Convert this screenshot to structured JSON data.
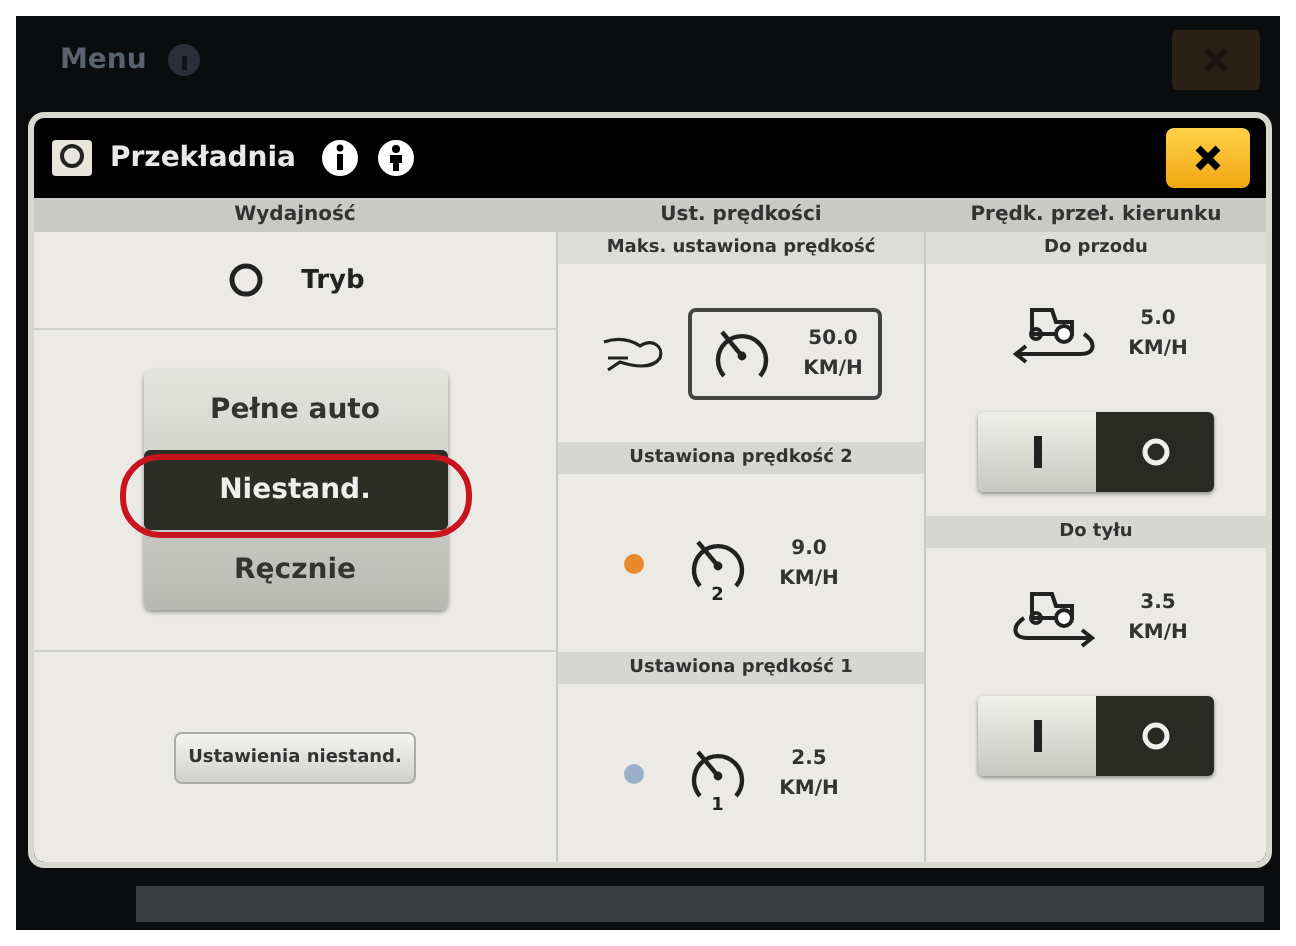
{
  "menu_bar": {
    "title": "Menu"
  },
  "dialog": {
    "title": "Przekładnia",
    "performance": {
      "heading": "Wydajność",
      "mode_label": "Tryb",
      "modes": [
        {
          "label": "Pełne auto",
          "selected": false
        },
        {
          "label": "Niestand.",
          "selected": true
        },
        {
          "label": "Ręcznie",
          "selected": false
        }
      ],
      "settings_button": "Ustawienia niestand."
    },
    "set_speeds": {
      "heading": "Ust. prędkości",
      "presets": [
        {
          "kind": "max",
          "label": "Maks. ustawiona prędkość",
          "value": "50.0",
          "unit": "KM/H",
          "selected": true
        },
        {
          "kind": "preset",
          "label": "Ustawiona prędkość 2",
          "number": "2",
          "value": "9.0",
          "unit": "KM/H",
          "selected": false,
          "color": "#e8892c"
        },
        {
          "kind": "preset",
          "label": "Ustawiona prędkość 1",
          "number": "1",
          "value": "2.5",
          "unit": "KM/H",
          "selected": false,
          "color": "#9ab0c8"
        }
      ]
    },
    "direction": {
      "heading": "Prędk. przeł. kierunku",
      "items": [
        {
          "kind": "forward",
          "label": "Do przodu",
          "value": "5.0",
          "unit": "KM/H",
          "on": false
        },
        {
          "kind": "reverse",
          "label": "Do tyłu",
          "value": "3.5",
          "unit": "KM/H",
          "on": false
        }
      ]
    }
  }
}
